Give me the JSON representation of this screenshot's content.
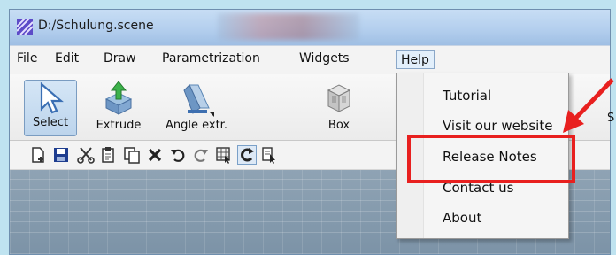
{
  "window": {
    "title": "D:/Schulung.scene"
  },
  "menubar": {
    "items": [
      "File",
      "Edit",
      "Draw",
      "Parametrization",
      "Widgets"
    ],
    "help_label": "Help"
  },
  "toolbar": {
    "tools": [
      {
        "label": "Select",
        "icon": "select-arrow-icon"
      },
      {
        "label": "Extrude",
        "icon": "extrude-icon"
      },
      {
        "label": "Angle extr.",
        "icon": "angle-extrude-icon"
      },
      {
        "label": "Box",
        "icon": "box-icon"
      }
    ],
    "partial_label": "S"
  },
  "help_menu": {
    "items": [
      "Tutorial",
      "Visit our website",
      "Release Notes",
      "Contact us",
      "About"
    ]
  },
  "annotation": {
    "color": "#e8201f"
  }
}
